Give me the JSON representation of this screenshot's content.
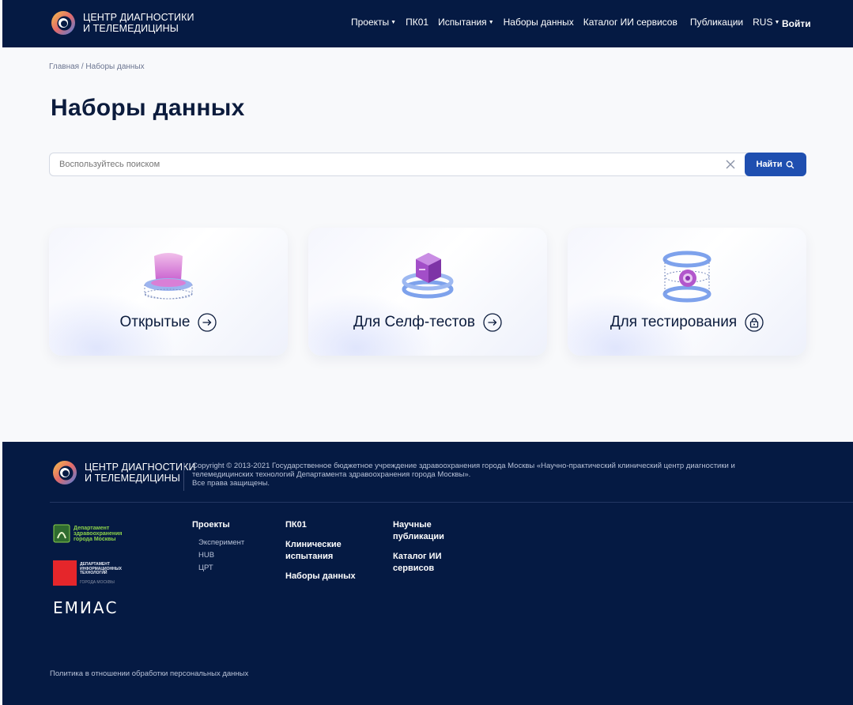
{
  "brand": {
    "line1": "ЦЕНТР ДИАГНОСТИКИ",
    "line2": "И ТЕЛЕМЕДИЦИНЫ"
  },
  "nav": {
    "items": [
      {
        "label": "Проекты",
        "dropdown": true
      },
      {
        "label": "ПК01",
        "dropdown": false
      },
      {
        "label": "Испытания",
        "dropdown": true
      },
      {
        "label": "Наборы данных",
        "dropdown": false
      },
      {
        "label": "Каталог ИИ сервисов",
        "dropdown": false
      },
      {
        "label": "Публикации",
        "dropdown": false
      }
    ],
    "language": "RUS",
    "login": "Войти"
  },
  "breadcrumb": {
    "home": "Главная",
    "separator": "/",
    "current": "Наборы данных"
  },
  "page": {
    "title": "Наборы данных"
  },
  "search": {
    "placeholder": "Воспользуйтесь поиском",
    "button": "Найти"
  },
  "cards": [
    {
      "label": "Открытые",
      "icon": "arrow-right-circle-icon"
    },
    {
      "label": "Для Селф-тестов",
      "icon": "arrow-right-circle-icon"
    },
    {
      "label": "Для тестирования",
      "icon": "lock-circle-icon"
    }
  ],
  "footer": {
    "copyright": "Copyright © 2013-2021 Государственное бюджетное учреждение здравоохранения города Москвы «Научно-практический клинический центр диагностики и телемедицинских технологий Департамента здравоохранения города Москвы».",
    "rights": "Все права защищены.",
    "col1": {
      "head": "Проекты",
      "subs": [
        "Эксперимент",
        "HUB",
        "ЦРТ"
      ]
    },
    "col2": [
      "ПК01",
      "Клинические испытания",
      "Наборы данных"
    ],
    "col3": [
      "Научные публикации",
      "Каталог ИИ сервисов"
    ],
    "partner1": [
      "Департамент",
      "здравоохранения",
      "города Москвы"
    ],
    "partner2": [
      "ДЕПАРТАМЕНТ",
      "ИНФОРМАЦИОННЫХ",
      "ТЕХНОЛОГИЙ",
      "ГОРОДА МОСКВЫ"
    ],
    "partner3": "ЕМИАС",
    "policy": "Политика в отношении обработки персональных данных"
  },
  "colors": {
    "navy": "#051a43",
    "accent": "#1f4fb0",
    "text": "#0c1c3d"
  }
}
